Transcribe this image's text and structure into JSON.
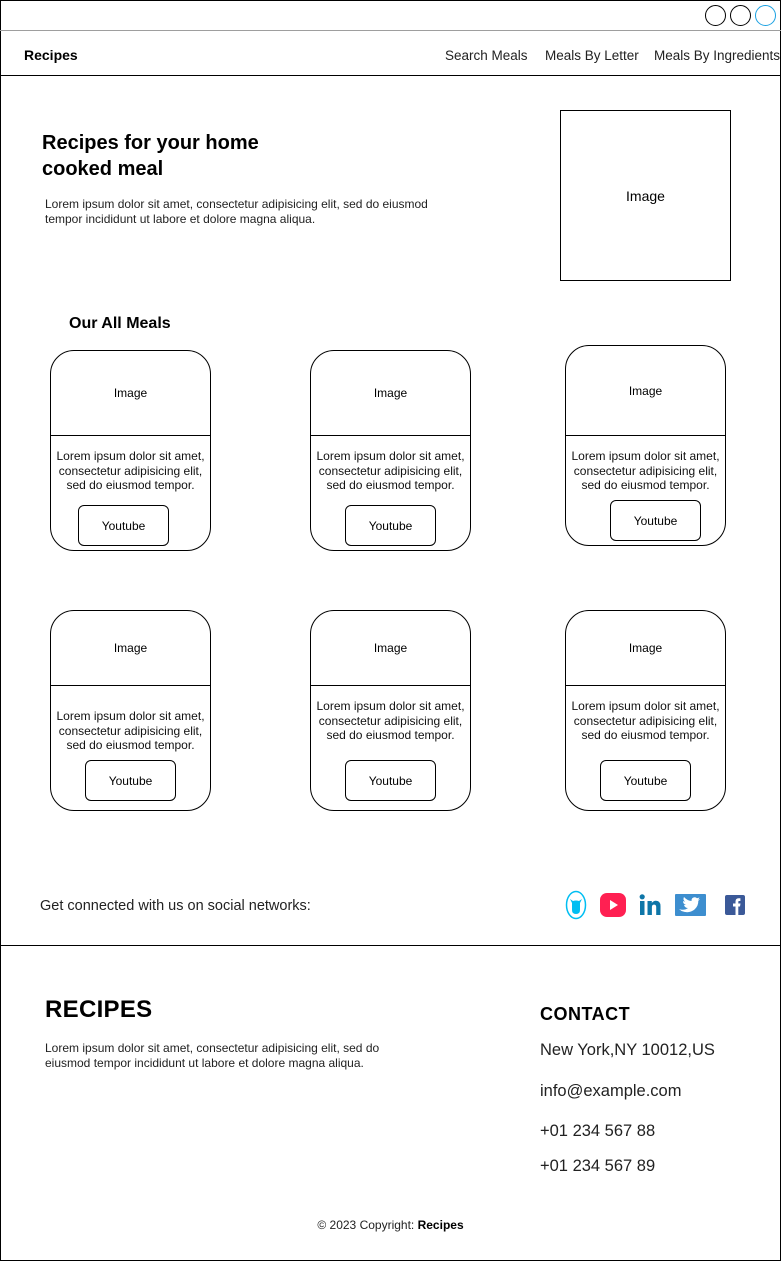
{
  "nav": {
    "brand": "Recipes",
    "links": [
      "Search Meals",
      "Meals By Letter",
      "Meals By Ingredients"
    ]
  },
  "hero": {
    "title": "Recipes for your home cooked meal",
    "text": "Lorem ipsum dolor sit amet, consectetur adipisicing elit, sed do eiusmod tempor incididunt ut labore et dolore magna aliqua.",
    "image_label": "Image"
  },
  "meals": {
    "title": "Our All Meals",
    "cards": [
      {
        "image": "Image",
        "text": "Lorem ipsum dolor sit amet, consectetur adipisicing elit, sed do eiusmod tempor.",
        "button": "Youtube"
      },
      {
        "image": "Image",
        "text": "Lorem ipsum dolor sit amet, consectetur adipisicing elit, sed do eiusmod tempor.",
        "button": "Youtube"
      },
      {
        "image": "Image",
        "text": "Lorem ipsum dolor sit amet, consectetur adipisicing elit, sed do eiusmod tempor.",
        "button": "Youtube"
      },
      {
        "image": "Image",
        "text": "Lorem ipsum dolor sit amet, consectetur adipisicing elit, sed do eiusmod tempor.",
        "button": "Youtube"
      },
      {
        "image": "Image",
        "text": "Lorem ipsum dolor sit amet, consectetur adipisicing elit, sed do eiusmod tempor.",
        "button": "Youtube"
      },
      {
        "image": "Image",
        "text": "Lorem ipsum dolor sit amet, consectetur adipisicing elit, sed do eiusmod tempor.",
        "button": "Youtube"
      }
    ]
  },
  "social": {
    "text": "Get connected with us on social networks:",
    "icons": [
      "github-icon",
      "youtube-icon",
      "linkedin-icon",
      "twitter-icon",
      "facebook-icon"
    ],
    "colors": {
      "github": "#00BEF2",
      "youtube": "#FF2052",
      "linkedin": "#0E76A8",
      "twitter": "#3D8ECF",
      "facebook": "#3B5998"
    }
  },
  "footer": {
    "brand": "RECIPES",
    "text": "Lorem ipsum dolor sit amet, consectetur adipisicing elit, sed do eiusmod tempor incididunt ut labore et dolore magna aliqua.",
    "contact_title": "CONTACT",
    "address": "New York,NY 10012,US",
    "email": "info@example.com",
    "phone1": "+01 234 567 88",
    "phone2": "+01 234 567 89",
    "copyright_prefix": "© 2023 Copyright: ",
    "copyright_brand": "Recipes"
  }
}
